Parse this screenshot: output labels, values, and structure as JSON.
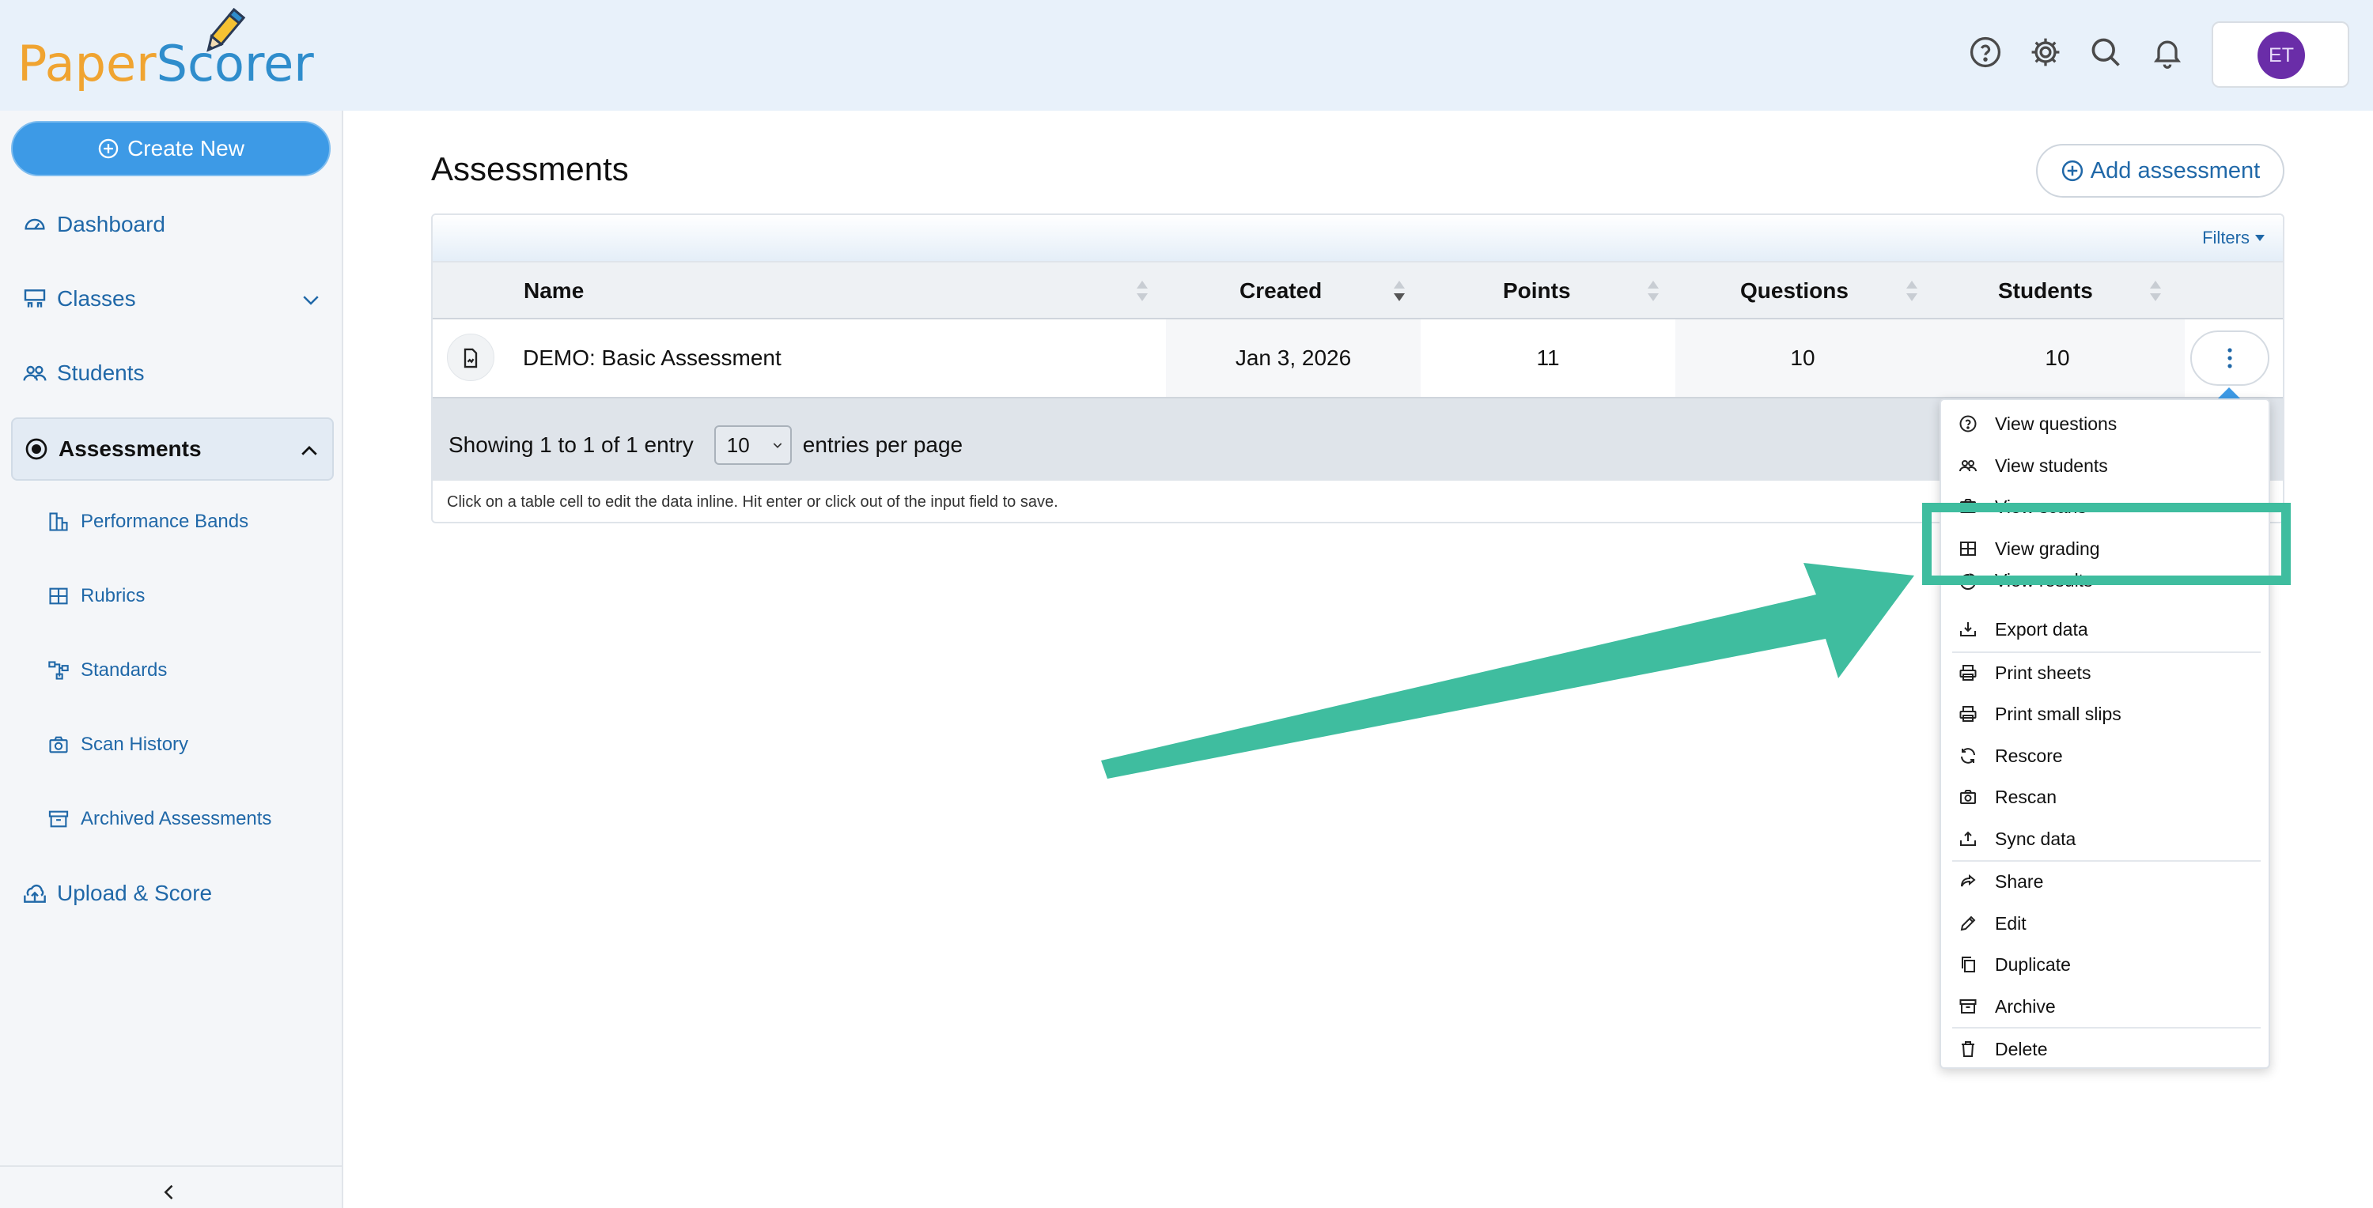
{
  "app": {
    "logo_part1": "Paper",
    "logo_part2": "Scorer",
    "avatar_initials": "ET",
    "brand_orange": "#f0a431",
    "brand_blue": "#2f8dcc"
  },
  "header_icons": [
    "help-circle-icon",
    "gear-icon",
    "search-icon",
    "bell-icon"
  ],
  "sidebar": {
    "create_label": "Create New",
    "items": [
      {
        "label": "Dashboard",
        "icon": "gauge-icon"
      },
      {
        "label": "Classes",
        "icon": "classroom-icon"
      },
      {
        "label": "Students",
        "icon": "users-icon"
      },
      {
        "label": "Assessments",
        "icon": "radio-dot-icon"
      },
      {
        "label": "Upload & Score",
        "icon": "cloud-upload-icon"
      }
    ],
    "sub_items": [
      {
        "label": "Performance Bands",
        "icon": "bands-icon"
      },
      {
        "label": "Rubrics",
        "icon": "grid-icon"
      },
      {
        "label": "Standards",
        "icon": "hierarchy-icon"
      },
      {
        "label": "Scan History",
        "icon": "camera-icon"
      },
      {
        "label": "Archived Assessments",
        "icon": "archive-icon"
      }
    ]
  },
  "main": {
    "title": "Assessments",
    "add_label": "Add assessment",
    "filters_label": "Filters",
    "columns": [
      "Name",
      "Created",
      "Points",
      "Questions",
      "Students"
    ],
    "rows": [
      {
        "name": "DEMO: Basic Assessment",
        "created": "Jan 3, 2026",
        "points": "11",
        "questions": "10",
        "students": "10"
      }
    ],
    "showing_text": "Showing 1 to 1 of 1 entry",
    "per_page_value": "10",
    "per_page_suffix": "entries per page",
    "hint": "Click on a table cell to edit the data inline. Hit enter or click out of the input field to save."
  },
  "menu": {
    "items": [
      {
        "label": "View questions",
        "icon": "question-circle-icon"
      },
      {
        "label": "View students",
        "icon": "users-icon"
      },
      {
        "label": "View scans",
        "icon": "camera-icon"
      },
      {
        "label": "View grading",
        "icon": "table-icon"
      },
      {
        "label": "View results",
        "icon": "pie-chart-icon"
      },
      {
        "label": "Export data",
        "icon": "download-tray-icon"
      },
      {
        "label": "Print sheets",
        "icon": "printer-icon"
      },
      {
        "label": "Print small slips",
        "icon": "printer-icon"
      },
      {
        "label": "Rescore",
        "icon": "refresh-icon"
      },
      {
        "label": "Rescan",
        "icon": "camera-icon"
      },
      {
        "label": "Sync data",
        "icon": "upload-tray-icon"
      },
      {
        "label": "Share",
        "icon": "share-icon"
      },
      {
        "label": "Edit",
        "icon": "pencil-icon"
      },
      {
        "label": "Duplicate",
        "icon": "copy-icon"
      },
      {
        "label": "Archive",
        "icon": "archive-icon"
      },
      {
        "label": "Delete",
        "icon": "trash-icon"
      }
    ]
  },
  "annotation": {
    "color": "#3fbd9f"
  }
}
